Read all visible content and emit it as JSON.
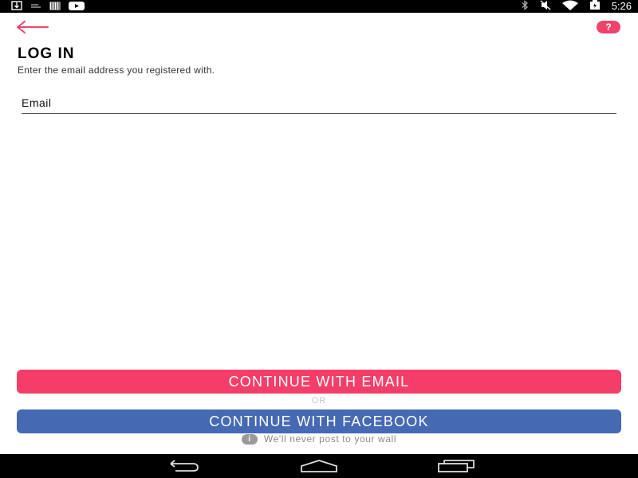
{
  "status_bar": {
    "time": "5:26",
    "icons": [
      "download-icon",
      "notification-icon",
      "gallery-icon",
      "youtube-icon",
      "bluetooth-icon",
      "mute-icon",
      "wifi-icon",
      "battery-icon"
    ]
  },
  "header": {
    "back_icon": "arrow-left-icon",
    "help_label": "?"
  },
  "login": {
    "title": "LOG IN",
    "subtitle": "Enter the email address you registered with.",
    "email_placeholder": "Email"
  },
  "actions": {
    "email_button": "CONTINUE WITH EMAIL",
    "or_label": "OR",
    "facebook_button": "CONTINUE WITH FACEBOOK",
    "disclaimer": "We'll never post to your wall",
    "info_glyph": "i"
  },
  "nav_bar": {
    "items": [
      "back-icon",
      "home-icon",
      "recents-icon"
    ]
  },
  "colors": {
    "accent": "#f43e69",
    "facebook": "#4569b3"
  }
}
